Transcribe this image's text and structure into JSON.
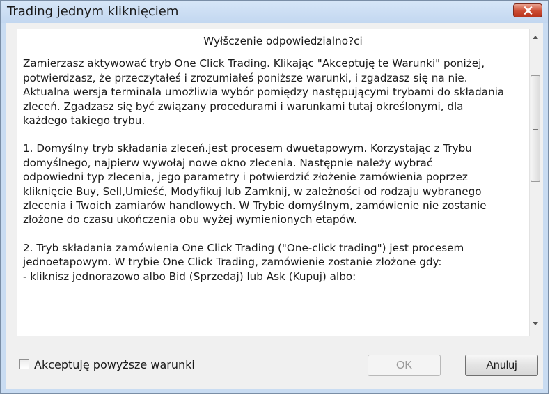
{
  "window": {
    "title": "Trading jednym kliknięciem"
  },
  "disclaimer": {
    "heading": "Wyłšczenie odpowiedzialno?ci",
    "paragraphs": [
      [
        "Zamierzasz aktywować tryb One Click Trading. Klikając \"Akceptuję te Warunki\" poniżej,",
        "potwierdzasz, że przeczytałeś i zrozumiałeś poniższe warunki, i zgadzasz się na nie.",
        "Aktualna wersja terminala umożliwia wybór pomiędzy następującymi trybami do składania",
        "zleceń. Zgadzasz się być związany procedurami i warunkami tutaj określonymi, dla",
        "każdego takiego trybu."
      ],
      [
        "1. Domyślny tryb składania zleceń.jest procesem dwuetapowym. Korzystając z Trybu",
        "domyślnego, najpierw wywołaj  nowe okno zlecenia. Następnie należy wybrać",
        "odpowiedni typ zlecenia, jego parametry i potwierdzić złożenie zamówienia poprzez",
        "kliknięcie Buy, Sell,Umieść, Modyfikuj lub Zamknij, w zależności od rodzaju wybranego",
        "zlecenia i Twoich zamiarów handlowych. W Trybie domyślnym, zamówienie nie zostanie",
        "złożone do czasu ukończenia obu wyżej wymienionych etapów."
      ],
      [
        "2. Tryb składania zamówienia One Click Trading (\"One-click trading\") jest procesem",
        "jednoetapowym. W trybie One Click Trading, zamówienie zostanie złożone gdy:",
        "- kliknisz jednorazowo albo Bid (Sprzedaj) lub Ask (Kupuj) albo:"
      ]
    ]
  },
  "accept_checkbox": {
    "label": "Akceptuję powyższe warunki",
    "checked": false
  },
  "buttons": {
    "ok": "OK",
    "ok_enabled": false,
    "cancel": "Anuluj"
  },
  "icons": {
    "close": "close-icon",
    "scroll_up": "scroll-up-arrow-icon",
    "scroll_down": "scroll-down-arrow-icon"
  },
  "colors": {
    "titlebar": "#c9dcf2",
    "close_button": "#cc4c32",
    "dialog_background": "#f0f0f0"
  }
}
